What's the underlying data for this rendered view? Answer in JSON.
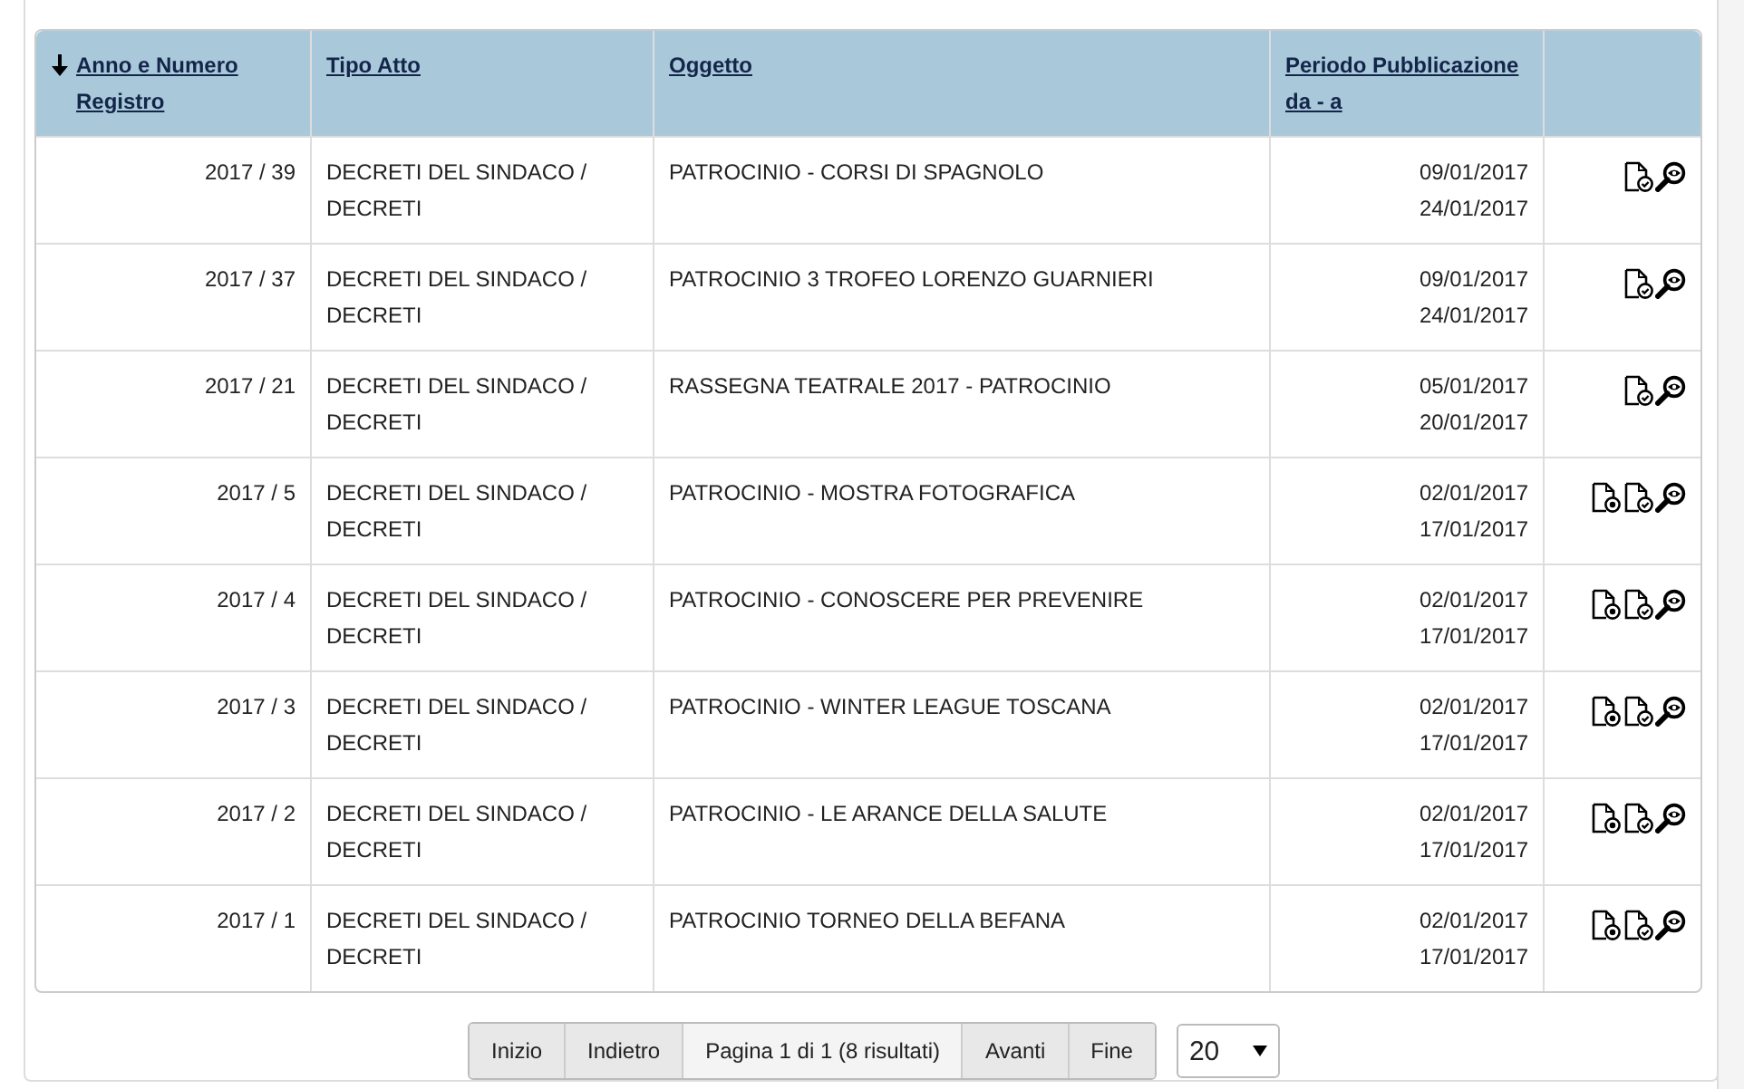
{
  "table": {
    "columns": [
      {
        "label": "Anno e Numero Registro",
        "sorted": true
      },
      {
        "label": "Tipo Atto",
        "sorted": false
      },
      {
        "label": "Oggetto",
        "sorted": false
      },
      {
        "label": "Periodo Pubblicazione da - a",
        "sorted": false
      }
    ],
    "rows": [
      {
        "number": "2017 / 39",
        "type": "DECRETI DEL SINDACO / DECRETI",
        "subject": "PATROCINIO - CORSI DI SPAGNOLO",
        "from": "09/01/2017",
        "to": "24/01/2017",
        "actions": [
          {
            "kind": "certificate"
          },
          {
            "kind": "view"
          }
        ]
      },
      {
        "number": "2017 / 37",
        "type": "DECRETI DEL SINDACO / DECRETI",
        "subject": "PATROCINIO 3 TROFEO LORENZO GUARNIERI",
        "from": "09/01/2017",
        "to": "24/01/2017",
        "actions": [
          {
            "kind": "certificate"
          },
          {
            "kind": "view"
          }
        ]
      },
      {
        "number": "2017 / 21",
        "type": "DECRETI DEL SINDACO / DECRETI",
        "subject": "RASSEGNA TEATRALE 2017 - PATROCINIO",
        "from": "05/01/2017",
        "to": "20/01/2017",
        "actions": [
          {
            "kind": "certificate"
          },
          {
            "kind": "view"
          }
        ]
      },
      {
        "number": "2017 / 5",
        "type": "DECRETI DEL SINDACO / DECRETI",
        "subject": "PATROCINIO - MOSTRA FOTOGRAFICA",
        "from": "02/01/2017",
        "to": "17/01/2017",
        "actions": [
          {
            "kind": "attachment"
          },
          {
            "kind": "certificate"
          },
          {
            "kind": "view"
          }
        ]
      },
      {
        "number": "2017 / 4",
        "type": "DECRETI DEL SINDACO / DECRETI",
        "subject": "PATROCINIO - CONOSCERE PER PREVENIRE",
        "from": "02/01/2017",
        "to": "17/01/2017",
        "actions": [
          {
            "kind": "attachment"
          },
          {
            "kind": "certificate"
          },
          {
            "kind": "view"
          }
        ]
      },
      {
        "number": "2017 / 3",
        "type": "DECRETI DEL SINDACO / DECRETI",
        "subject": "PATROCINIO - WINTER LEAGUE TOSCANA",
        "from": "02/01/2017",
        "to": "17/01/2017",
        "actions": [
          {
            "kind": "attachment"
          },
          {
            "kind": "certificate"
          },
          {
            "kind": "view"
          }
        ]
      },
      {
        "number": "2017 / 2",
        "type": "DECRETI DEL SINDACO / DECRETI",
        "subject": "PATROCINIO - LE ARANCE DELLA SALUTE",
        "from": "02/01/2017",
        "to": "17/01/2017",
        "actions": [
          {
            "kind": "attachment"
          },
          {
            "kind": "certificate"
          },
          {
            "kind": "view"
          }
        ]
      },
      {
        "number": "2017 / 1",
        "type": "DECRETI DEL SINDACO / DECRETI",
        "subject": "PATROCINIO TORNEO DELLA BEFANA",
        "from": "02/01/2017",
        "to": "17/01/2017",
        "actions": [
          {
            "kind": "attachment"
          },
          {
            "kind": "certificate"
          },
          {
            "kind": "view"
          }
        ]
      }
    ]
  },
  "pagination": {
    "buttons": [
      {
        "label": "Inizio",
        "kind": "button"
      },
      {
        "label": "Indietro",
        "kind": "button"
      },
      {
        "label": "Pagina 1 di 1 (8 risultati)",
        "kind": "info"
      },
      {
        "label": "Avanti",
        "kind": "button"
      },
      {
        "label": "Fine",
        "kind": "button"
      }
    ],
    "page_size": "20"
  }
}
